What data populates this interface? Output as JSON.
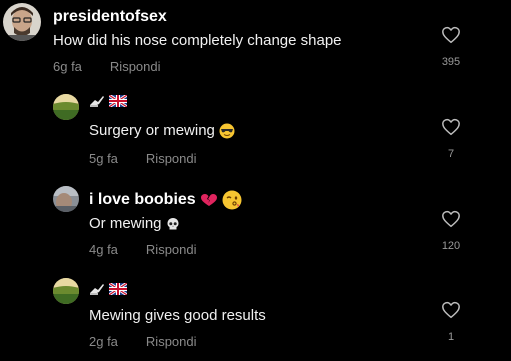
{
  "comments": [
    {
      "username": "presidentofsex",
      "text": "How did his nose completely change shape",
      "time": "6g fa",
      "reply": "Rispondi",
      "likes": "395"
    },
    {
      "username": "",
      "username_icons": [
        "writing-hand-emoji",
        "uk-flag-emoji"
      ],
      "text": "Surgery or mewing",
      "text_emoji": "sunglasses-face-emoji",
      "time": "5g fa",
      "reply": "Rispondi",
      "likes": "7"
    },
    {
      "username": "i love boobies",
      "username_icons": [
        "broken-heart-emoji",
        "winking-kiss-emoji"
      ],
      "text": "Or mewing",
      "text_emoji": "skull-emoji",
      "time": "4g fa",
      "reply": "Rispondi",
      "likes": "120"
    },
    {
      "username": "",
      "username_icons": [
        "writing-hand-emoji",
        "uk-flag-emoji"
      ],
      "text": "Mewing gives good results",
      "time": "2g fa",
      "reply": "Rispondi",
      "likes": "1"
    }
  ],
  "colors": {
    "background": "#000000",
    "text": "#ffffff",
    "muted": "#8a8a8a",
    "heart_outline": "#bdbdbd"
  }
}
